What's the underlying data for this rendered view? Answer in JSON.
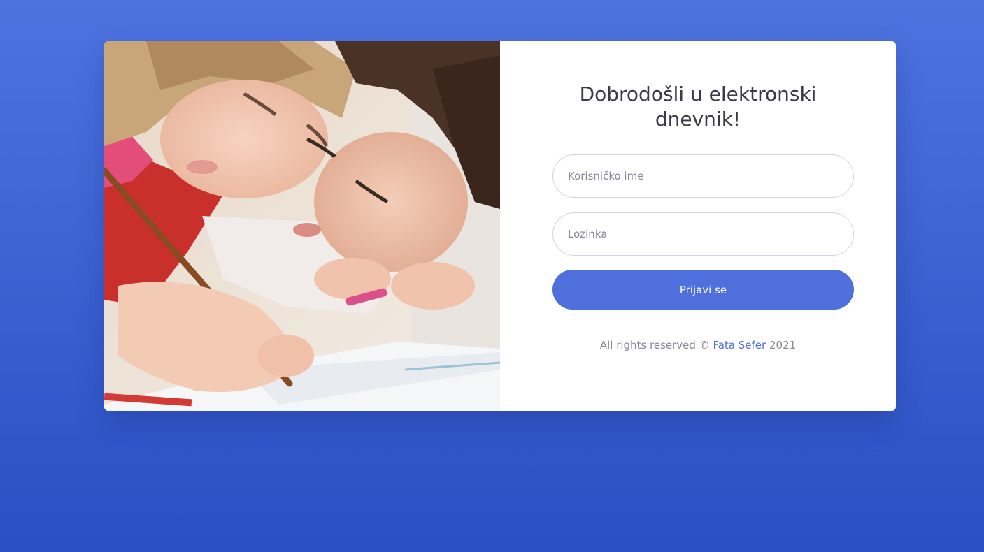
{
  "login": {
    "title": "Dobrodošli u elektronski dnevnik!",
    "username_placeholder": "Korisničko ime",
    "password_placeholder": "Lozinka",
    "submit_label": "Prijavi se"
  },
  "footer": {
    "prefix": "All rights reserved ©",
    "author_link": "Fata Sefer",
    "year": "2021"
  },
  "colors": {
    "background": "#4e73df",
    "accent": "#4e6fdc"
  },
  "image": {
    "icon": "children-drawing-photo"
  }
}
